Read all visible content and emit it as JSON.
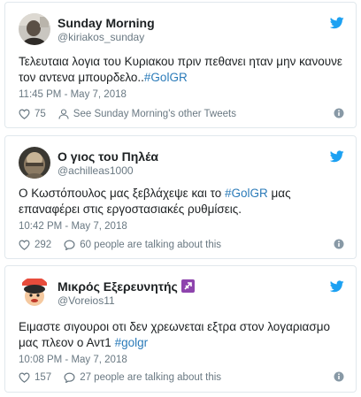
{
  "tweets": [
    {
      "display_name": "Sunday Morning",
      "handle": "@kiriakos_sunday",
      "text": "Τελευταια λογια του Κυριακου πριν πεθανει ηταν μην κανουνε τον αντενα μπουρδελο..",
      "hashtag": "#GolGR",
      "timestamp": "11:45 PM - May 7, 2018",
      "like_count": "75",
      "secondary_action": "See Sunday Morning's other Tweets"
    },
    {
      "display_name": "Ο γιος του Πηλέα",
      "handle": "@achilleas1000",
      "text_before": "Ο Κωστόπουλος μας ξεβλάχεψε και το ",
      "hashtag": "#GolGR",
      "text_after": " μας επαναφέρει στις εργοστασιακές ρυθμίσεις.",
      "timestamp": "10:42 PM - May 7, 2018",
      "like_count": "292",
      "secondary_action": "60 people are talking about this"
    },
    {
      "display_name": "Μικρός Εξερευνητής",
      "display_name_emoji": "sagittarius-emoji",
      "handle": "@Voreios11",
      "text": "Ειμαστε σιγουροι οτι δεν χρεωνεται εξτρα στον λογαριασμο μας πλεον ο Αντ1 ",
      "hashtag": "#golgr",
      "timestamp": "10:08 PM - May 7, 2018",
      "like_count": "157",
      "secondary_action": "27 people are talking about this"
    }
  ],
  "colors": {
    "link": "#2b7bb9",
    "twitter_blue": "#1da1f2",
    "muted": "#697882",
    "border": "#e1e8ed"
  },
  "icons": [
    "twitter-bird-icon",
    "heart-icon",
    "person-icon",
    "speech-bubble-icon",
    "info-icon"
  ]
}
